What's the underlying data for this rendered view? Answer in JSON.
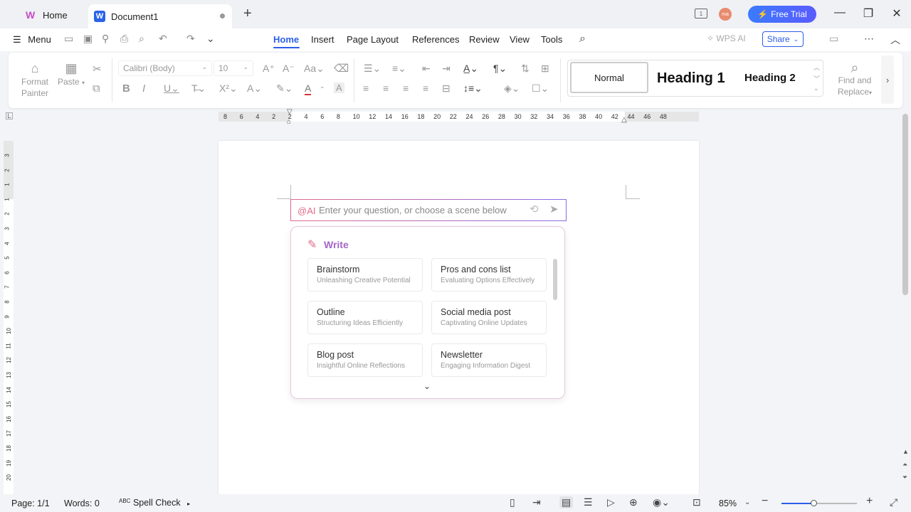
{
  "titlebar": {
    "home_tab": "Home",
    "doc_tab": "Document1",
    "new_tab": "+",
    "free_trial": "Free Trial",
    "avatar": "ma"
  },
  "menubar": {
    "menu": "Menu",
    "tabs": [
      "Home",
      "Insert",
      "Page Layout",
      "References",
      "Review",
      "View",
      "Tools"
    ],
    "wps_ai": "WPS AI",
    "share": "Share"
  },
  "ribbon": {
    "format_painter": [
      "Format",
      "Painter"
    ],
    "paste": "Paste",
    "font_name": "Calibri (Body)",
    "font_size": "10",
    "styles": {
      "normal": "Normal",
      "heading1": "Heading 1",
      "heading2": "Heading 2"
    },
    "find_replace": [
      "Find and",
      "Replace"
    ]
  },
  "ruler": {
    "h_ticks": [
      "8",
      "6",
      "4",
      "2",
      "2",
      "4",
      "6",
      "8",
      "10",
      "12",
      "14",
      "16",
      "18",
      "20",
      "22",
      "24",
      "26",
      "28",
      "30",
      "32",
      "34",
      "36",
      "38",
      "40",
      "42",
      "44",
      "46",
      "48"
    ],
    "v_ticks": [
      "3",
      "2",
      "1",
      "1",
      "2",
      "3",
      "4",
      "5",
      "6",
      "7",
      "8",
      "9",
      "10",
      "11",
      "12",
      "13",
      "14",
      "15",
      "16",
      "17",
      "18",
      "19",
      "20"
    ]
  },
  "ai": {
    "at": "@AI",
    "placeholder": "Enter your question, or choose a scene below",
    "section": "Write",
    "cards": [
      {
        "title": "Brainstorm",
        "subtitle": "Unleashing Creative Potential"
      },
      {
        "title": "Pros and cons list",
        "subtitle": "Evaluating Options Effectively"
      },
      {
        "title": "Outline",
        "subtitle": "Structuring Ideas Efficiently"
      },
      {
        "title": "Social media post",
        "subtitle": "Captivating Online Updates"
      },
      {
        "title": "Blog post",
        "subtitle": "Insightful Online Reflections"
      },
      {
        "title": "Newsletter",
        "subtitle": "Engaging Information Digest"
      }
    ]
  },
  "status": {
    "page": "Page: 1/1",
    "words": "Words: 0",
    "spell": "Spell Check",
    "zoom": "85%",
    "zoom_level": 0.42
  }
}
